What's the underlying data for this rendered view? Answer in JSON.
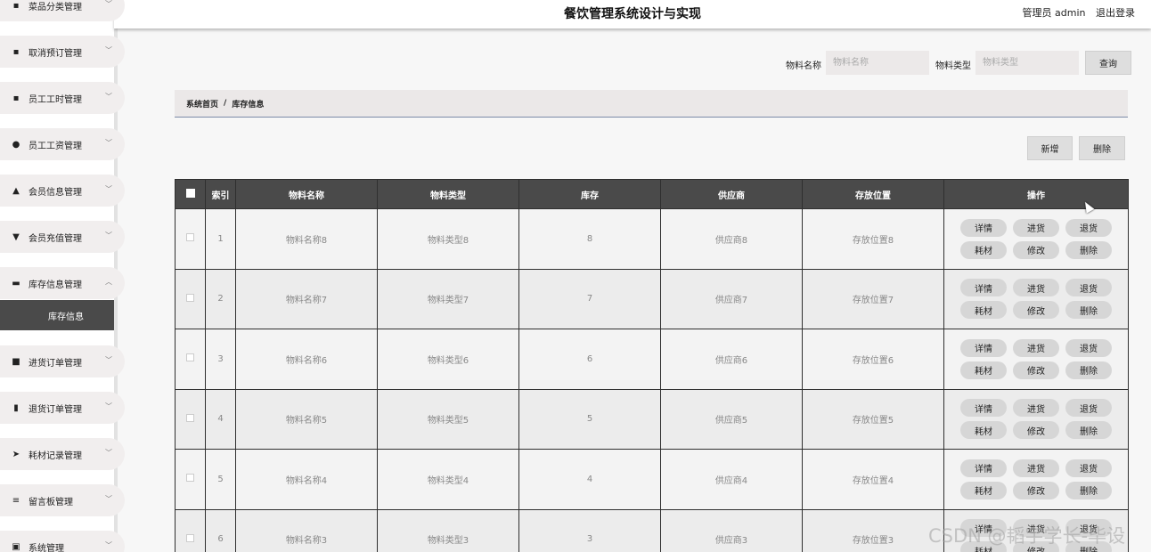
{
  "header": {
    "title": "餐饮管理系统设计与实现",
    "user": "管理员 admin",
    "logout": "退出登录"
  },
  "sidebar": {
    "items": [
      {
        "label": "菜品分类管理",
        "icon": "grid-icon",
        "expanded": false
      },
      {
        "label": "取消预订管理",
        "icon": "grid-icon",
        "expanded": false
      },
      {
        "label": "员工工时管理",
        "icon": "grid-icon",
        "expanded": false
      },
      {
        "label": "员工工资管理",
        "icon": "location-pin-icon",
        "expanded": false
      },
      {
        "label": "会员信息管理",
        "icon": "user-icon",
        "expanded": false
      },
      {
        "label": "会员充值管理",
        "icon": "cup-icon",
        "expanded": false
      },
      {
        "label": "库存信息管理",
        "icon": "monitor-icon",
        "expanded": true,
        "sub": "库存信息"
      },
      {
        "label": "进货订单管理",
        "icon": "chat-icon",
        "expanded": false
      },
      {
        "label": "退货订单管理",
        "icon": "bar-chart-icon",
        "expanded": false
      },
      {
        "label": "耗材记录管理",
        "icon": "send-icon",
        "expanded": false
      },
      {
        "label": "留言板管理",
        "icon": "sliders-icon",
        "expanded": false
      },
      {
        "label": "系统管理",
        "icon": "clipboard-icon",
        "expanded": false
      }
    ]
  },
  "search": {
    "name_label": "物料名称",
    "name_placeholder": "物料名称",
    "type_label": "物料类型",
    "type_placeholder": "物料类型",
    "query_button": "查询"
  },
  "breadcrumb": {
    "home": "系统首页",
    "sep": "/",
    "current": "库存信息"
  },
  "actions": {
    "add": "新增",
    "delete": "删除"
  },
  "table": {
    "headers": [
      "索引",
      "物料名称",
      "物料类型",
      "库存",
      "供应商",
      "存放位置",
      "操作"
    ],
    "op_buttons": [
      "详情",
      "进货",
      "退货",
      "耗材",
      "修改",
      "删除"
    ],
    "rows": [
      {
        "index": "1",
        "name": "物料名称8",
        "type": "物料类型8",
        "stock": "8",
        "supplier": "供应商8",
        "location": "存放位置8"
      },
      {
        "index": "2",
        "name": "物料名称7",
        "type": "物料类型7",
        "stock": "7",
        "supplier": "供应商7",
        "location": "存放位置7"
      },
      {
        "index": "3",
        "name": "物料名称6",
        "type": "物料类型6",
        "stock": "6",
        "supplier": "供应商6",
        "location": "存放位置6"
      },
      {
        "index": "4",
        "name": "物料名称5",
        "type": "物料类型5",
        "stock": "5",
        "supplier": "供应商5",
        "location": "存放位置5"
      },
      {
        "index": "5",
        "name": "物料名称4",
        "type": "物料类型4",
        "stock": "4",
        "supplier": "供应商4",
        "location": "存放位置4"
      },
      {
        "index": "6",
        "name": "物料名称3",
        "type": "物料类型3",
        "stock": "3",
        "supplier": "供应商3",
        "location": "存放位置3"
      }
    ]
  },
  "watermark": "CSDN @韬宇学长-毕设"
}
